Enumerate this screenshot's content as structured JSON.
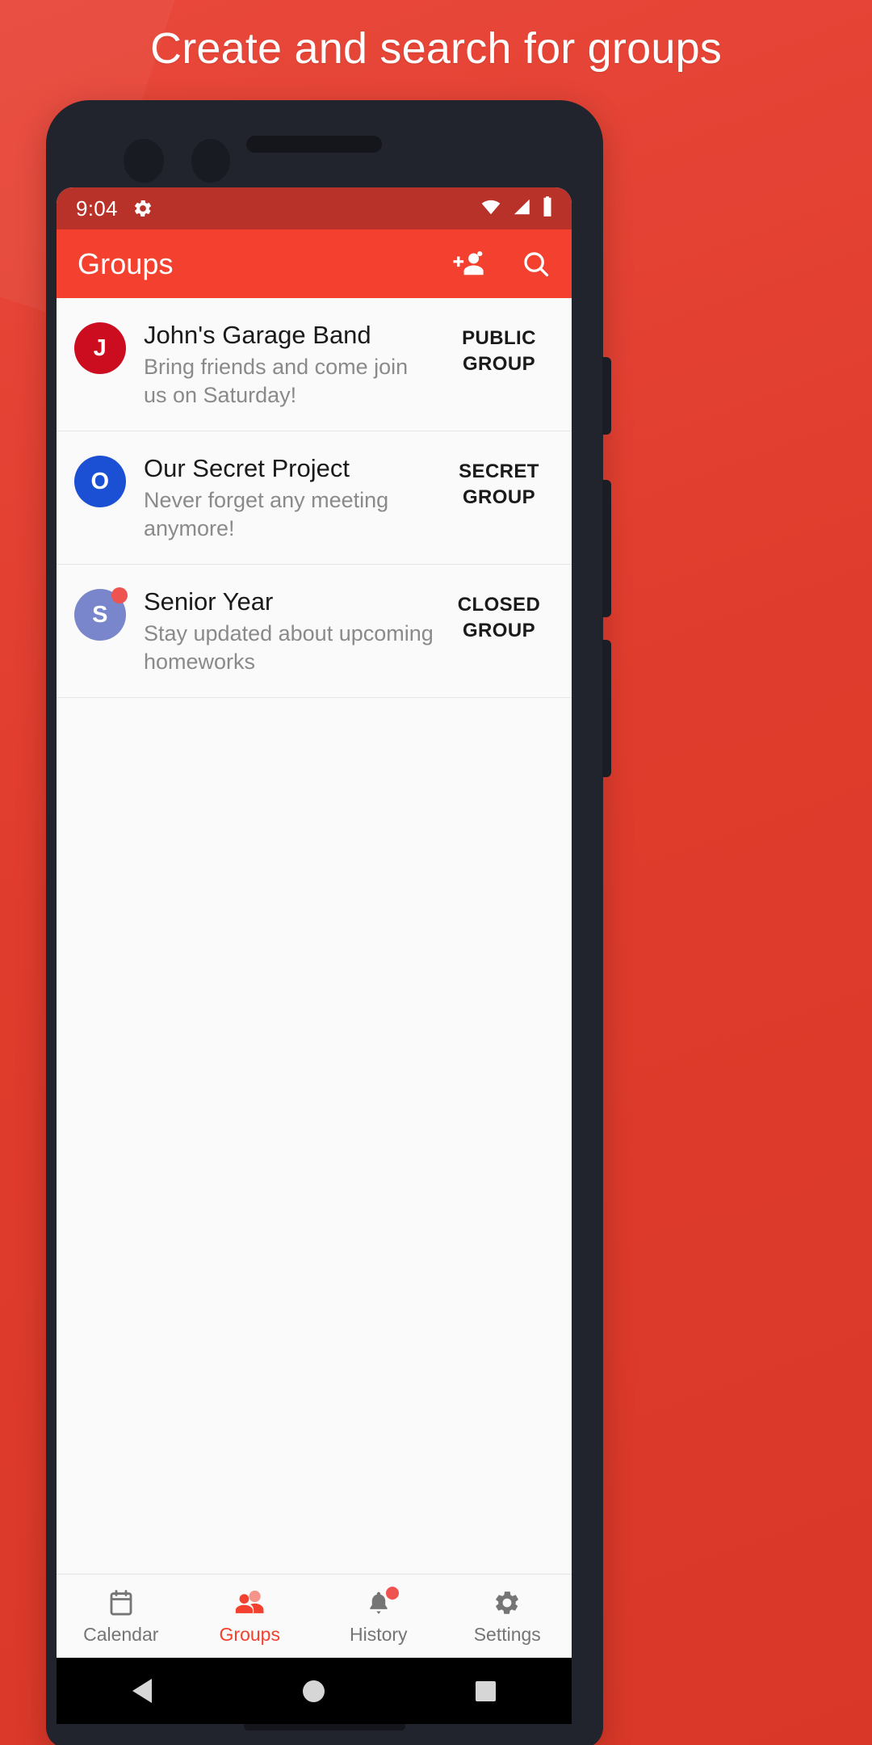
{
  "promo": {
    "headline": "Create and search for groups",
    "background_color": "#e8402f"
  },
  "statusbar": {
    "time": "9:04",
    "icons": [
      "gear-icon",
      "wifi-icon",
      "cellular-signal-icon",
      "battery-icon"
    ]
  },
  "appbar": {
    "title": "Groups",
    "actions": [
      {
        "name": "add-group-icon",
        "label": "Add group"
      },
      {
        "name": "search-icon",
        "label": "Search"
      }
    ],
    "color": "#f4402e"
  },
  "groups": [
    {
      "initial": "J",
      "avatar_color": "#cc0d1f",
      "title": "John's Garage Band",
      "subtitle": "Bring friends and come join us on Saturday!",
      "badge": "PUBLIC GROUP",
      "has_badge_dot": false
    },
    {
      "initial": "O",
      "avatar_color": "#1b4fd4",
      "title": "Our Secret Project",
      "subtitle": "Never forget any meeting anymore!",
      "badge": "SECRET GROUP",
      "has_badge_dot": false
    },
    {
      "initial": "S",
      "avatar_color": "#7986cb",
      "title": "Senior Year",
      "subtitle": "Stay updated about upcoming homeworks",
      "badge": "CLOSED GROUP",
      "has_badge_dot": true
    }
  ],
  "bottomnav": {
    "active_color": "#f4402e",
    "inactive_color": "#757575",
    "items": [
      {
        "label": "Calendar",
        "icon": "calendar-icon",
        "active": false,
        "badge": false
      },
      {
        "label": "Groups",
        "icon": "people-icon",
        "active": true,
        "badge": false
      },
      {
        "label": "History",
        "icon": "bell-icon",
        "active": false,
        "badge": true
      },
      {
        "label": "Settings",
        "icon": "gear-icon",
        "active": false,
        "badge": false
      }
    ]
  },
  "androidnav": {
    "buttons": [
      "back-button",
      "home-button",
      "recents-button"
    ]
  }
}
